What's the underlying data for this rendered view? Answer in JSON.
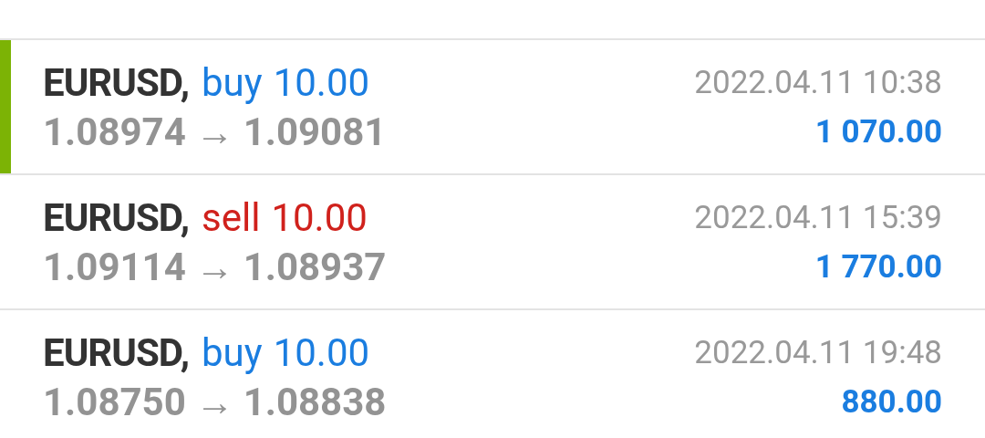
{
  "deals": [
    {
      "symbol": "EURUSD,",
      "type": "buy",
      "volume": "10.00",
      "time": "2022.04.11 10:38",
      "prices": "1.08974 → 1.09081",
      "profit": "1 070.00",
      "loss": false,
      "selected": true
    },
    {
      "symbol": "EURUSD,",
      "type": "sell",
      "volume": "10.00",
      "time": "2022.04.11 15:39",
      "prices": "1.09114 → 1.08937",
      "profit": "1 770.00",
      "loss": false,
      "selected": false
    },
    {
      "symbol": "EURUSD,",
      "type": "buy",
      "volume": "10.00",
      "time": "2022.04.11 19:48",
      "prices": "1.08750 → 1.08838",
      "profit": "880.00",
      "loss": false,
      "selected": false
    }
  ]
}
